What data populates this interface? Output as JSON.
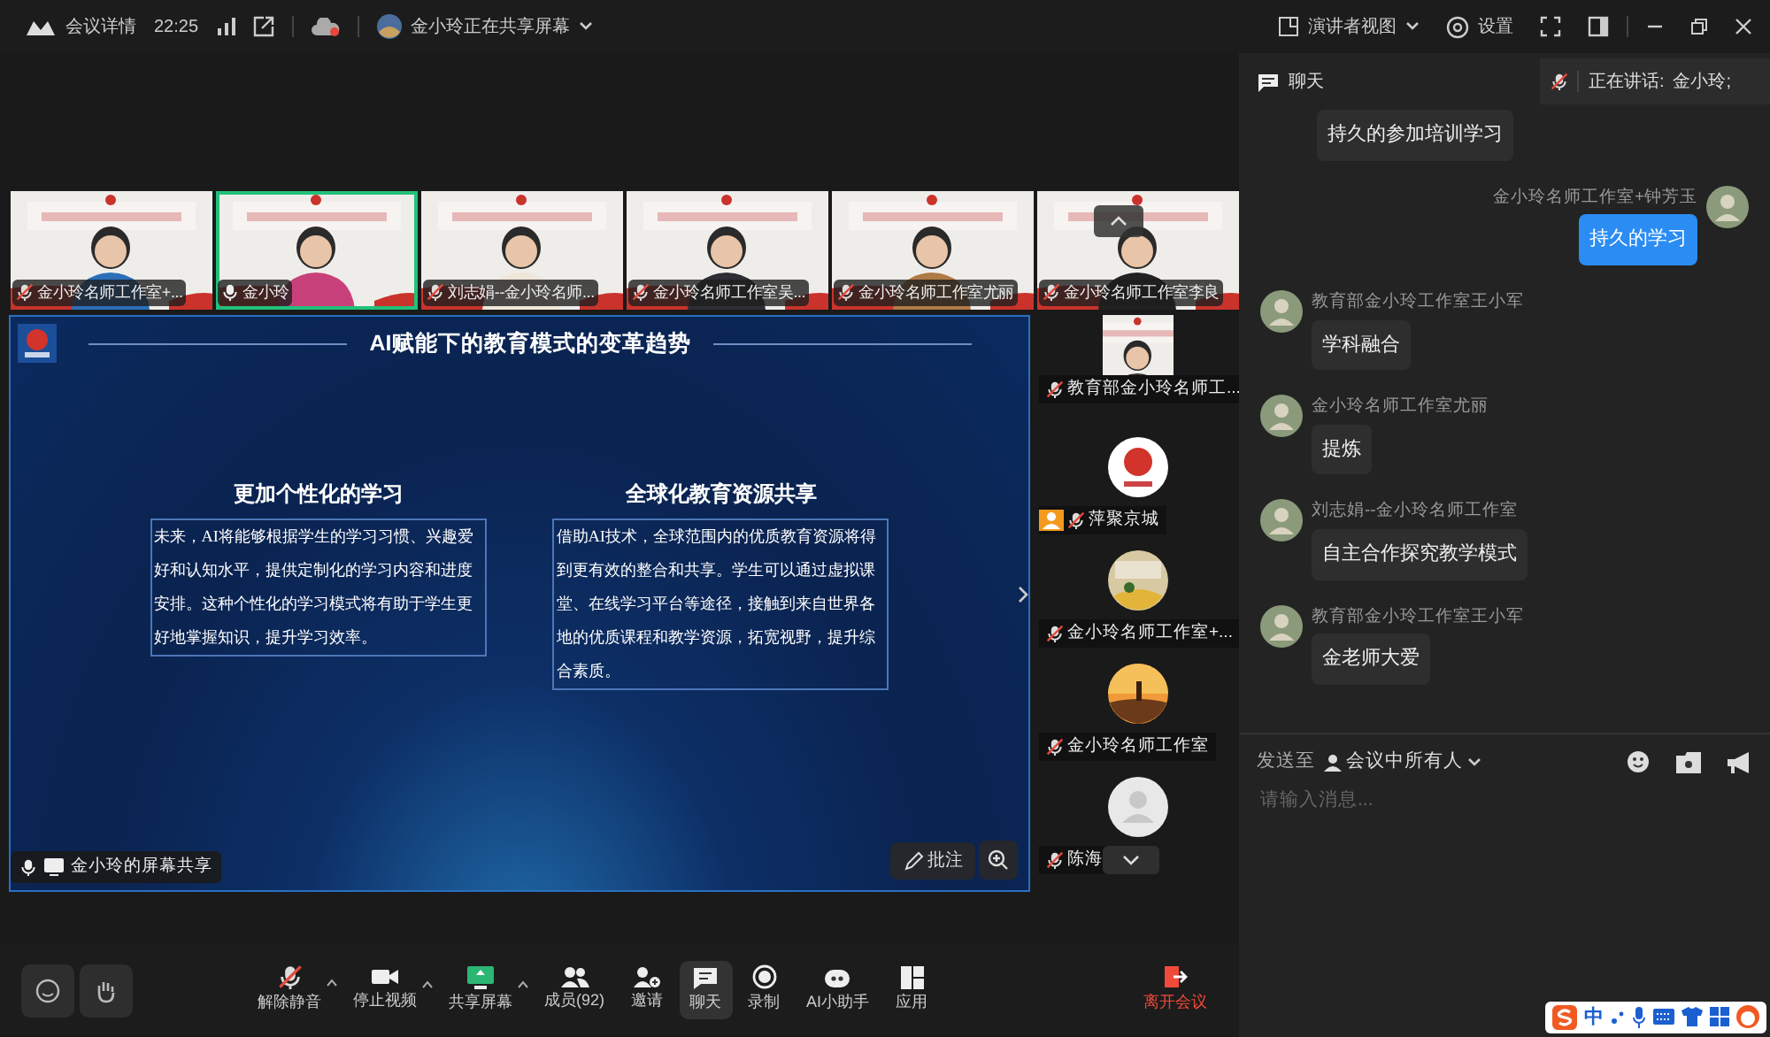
{
  "top_bar": {
    "meeting_details": "会议详情",
    "time": "22:25",
    "sharing_status": "金小玲正在共享屏幕",
    "view_mode": "演讲者视图",
    "settings": "设置"
  },
  "video_strip": [
    {
      "name": "金小玲名师工作室+...",
      "muted": true,
      "selected": false
    },
    {
      "name": "金小玲",
      "muted": false,
      "selected": true
    },
    {
      "name": "刘志娟--金小玲名师...",
      "muted": true,
      "selected": false
    },
    {
      "name": "金小玲名师工作室吴...",
      "muted": true,
      "selected": false
    },
    {
      "name": "金小玲名师工作室尤丽",
      "muted": true,
      "selected": false
    },
    {
      "name": "金小玲名师工作室李良",
      "muted": true,
      "selected": false
    }
  ],
  "slide": {
    "title": "AI赋能下的教育模式的变革趋势",
    "columns": [
      {
        "heading": "更加个性化的学习",
        "body": "未来，AI将能够根据学生的学习习惯、兴趣爱好和认知水平，提供定制化的学习内容和进度安排。这种个性化的学习模式将有助于学生更好地掌握知识，提升学习效率。"
      },
      {
        "heading": "全球化教育资源共享",
        "body": "借助AI技术，全球范围内的优质教育资源将得到更有效的整合和共享。学生可以通过虚拟课堂、在线学习平台等途径，接触到来自世界各地的优质课程和教学资源，拓宽视野，提升综合素质。"
      }
    ],
    "share_label": "金小玲的屏幕共享",
    "annotate": "批注"
  },
  "side_participants": [
    {
      "name": "教育部金小玲名师工...",
      "kind": "video",
      "muted": true
    },
    {
      "name": "萍聚京城",
      "kind": "logo",
      "muted": true
    },
    {
      "name": "金小玲名师工作室+...",
      "muted": true
    },
    {
      "name": "金小玲名师工作室",
      "kind": "sunset",
      "muted": true
    },
    {
      "name": "陈海",
      "kind": "default",
      "muted": true
    }
  ],
  "chat": {
    "title": "聊天",
    "speaking_label": "正在讲话:",
    "speaker": "金小玲;",
    "messages": [
      {
        "text": "持久的参加培训学习",
        "self": false
      },
      {
        "sender": "金小玲名师工作室+钟芳玉",
        "text": "持久的学习",
        "self": true
      },
      {
        "sender": "教育部金小玲工作室王小军",
        "text": "学科融合",
        "self": false
      },
      {
        "sender": "金小玲名师工作室尤丽",
        "text": "提炼",
        "self": false
      },
      {
        "sender": "刘志娟--金小玲名师工作室",
        "text": "自主合作探究教学模式",
        "self": false
      },
      {
        "sender": "教育部金小玲工作室王小军",
        "text": "金老师大爱",
        "self": false
      }
    ],
    "send_to_label": "发送至",
    "recipient": "会议中所有人",
    "input": {
      "placeholder": "请输入消息..."
    }
  },
  "toolbar": [
    {
      "label": "解除静音",
      "kind": "mic",
      "selected": false
    },
    {
      "label": "停止视频",
      "kind": "video",
      "selected": false
    },
    {
      "label": "共享屏幕",
      "kind": "share",
      "selected": false
    },
    {
      "label": "成员(92)",
      "kind": "members",
      "selected": false
    },
    {
      "label": "邀请",
      "kind": "invite",
      "selected": false
    },
    {
      "label": "聊天",
      "kind": "chat",
      "selected": true
    },
    {
      "label": "录制",
      "kind": "record",
      "selected": false
    },
    {
      "label": "AI小助手",
      "kind": "ai",
      "selected": false
    },
    {
      "label": "应用",
      "kind": "apps",
      "selected": false
    }
  ],
  "leave_button": "离开会议",
  "ime_bar": {
    "mode": "中"
  }
}
